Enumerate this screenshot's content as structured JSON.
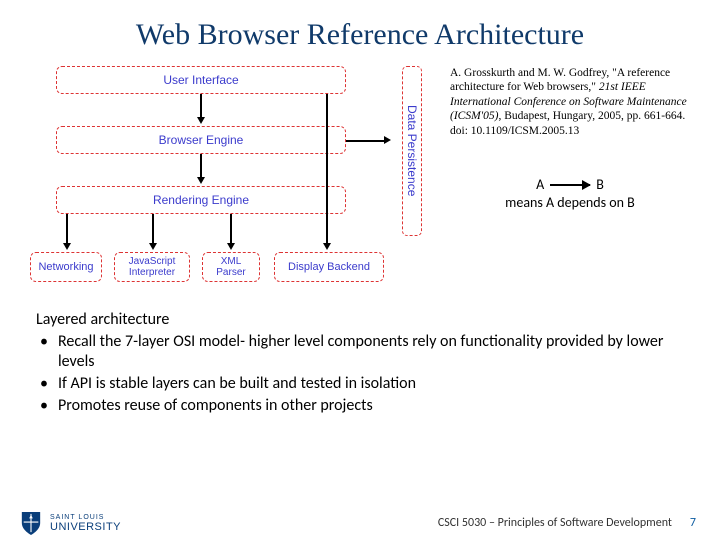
{
  "title": "Web Browser Reference Architecture",
  "diagram": {
    "boxes": {
      "ui": "User Interface",
      "browser_engine": "Browser Engine",
      "rendering_engine": "Rendering Engine",
      "networking": "Networking",
      "js": "JavaScript\nInterpreter",
      "xml": "XML\nParser",
      "display": "Display Backend",
      "persistence": "Data Persistence"
    }
  },
  "citation": {
    "authors": "A. Grosskurth and M. W. Godfrey, \"A reference architecture for Web browsers,\" ",
    "venue_italic": "21st IEEE International Conference on Software Maintenance (ICSM'05)",
    "rest": ", Budapest, Hungary, 2005, pp. 661-664.",
    "doi": "doi: 10.1109/ICSM.2005.13"
  },
  "legend": {
    "a": "A",
    "b": "B",
    "text": "means A depends on B"
  },
  "body": {
    "heading": "Layered architecture",
    "bullets": [
      "Recall the 7-layer OSI model- higher level components rely on functionality provided by lower levels",
      "If API is stable layers can be built and tested in isolation",
      "Promotes reuse of components in other projects"
    ]
  },
  "footer": {
    "org_top": "SAINT LOUIS",
    "org_bottom": "UNIVERSITY",
    "course": "CSCI 5030 – Principles of Software Development",
    "page": "7"
  }
}
